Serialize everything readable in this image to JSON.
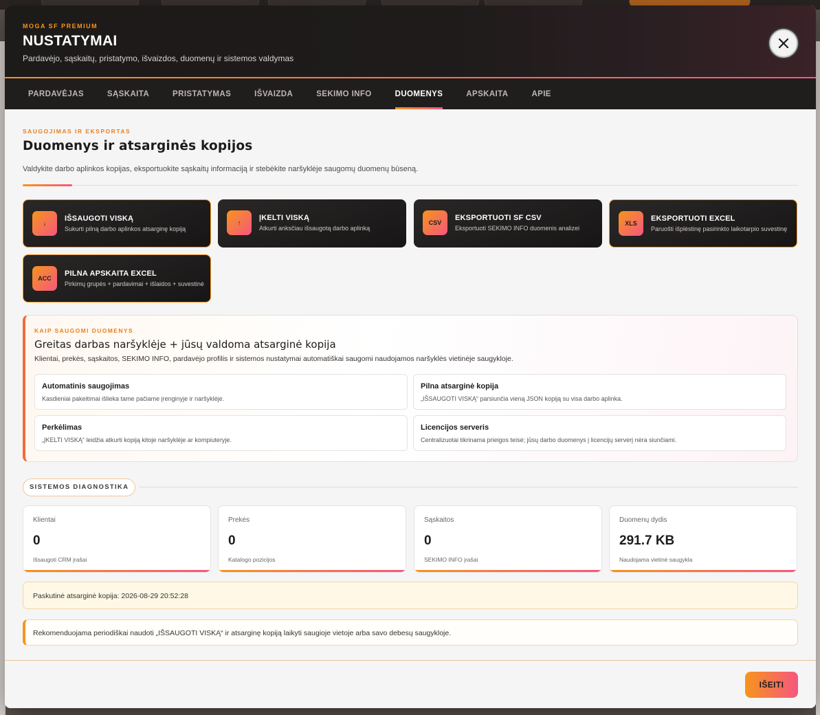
{
  "header": {
    "brand": "MOGA SF PREMIUM",
    "title": "NUSTATYMAI",
    "subtitle": "Pardavėjo, sąskaitų, pristatymo, išvaizdos, duomenų ir sistemos valdymas",
    "close_icon": "close-icon"
  },
  "tabs": [
    {
      "label": "PARDAVĖJAS"
    },
    {
      "label": "SĄSKAITA"
    },
    {
      "label": "PRISTATYMAS"
    },
    {
      "label": "IŠVAIZDA"
    },
    {
      "label": "SEKIMO INFO"
    },
    {
      "label": "DUOMENYS",
      "active": true
    },
    {
      "label": "APSKAITA"
    },
    {
      "label": "APIE"
    }
  ],
  "section": {
    "eyebrow": "SAUGOJIMAS IR EKSPORTAS",
    "title": "Duomenys ir atsarginės kopijos",
    "description": "Valdykite darbo aplinkos kopijas, eksportuokite sąskaitų informaciją ir stebėkite naršyklėje saugomų duomenų būseną."
  },
  "actions": [
    {
      "icon": "↓",
      "label": "IŠSAUGOTI VISKĄ",
      "sub": "Sukurti pilną darbo aplinkos atsarginę kopiją"
    },
    {
      "icon": "↑",
      "label": "ĮKELTI VISKĄ",
      "sub": "Atkurti anksčiau išsaugotą darbo aplinką"
    },
    {
      "icon": "CSV",
      "label": "EKSPORTUOTI SF CSV",
      "sub": "Eksportuoti SEKIMO INFO duomenis analizei"
    },
    {
      "icon": "XLS",
      "label": "EKSPORTUOTI EXCEL",
      "sub": "Paruošti išplėstinę pasirinkto laikotarpio suvestinę"
    },
    {
      "icon": "ACC",
      "label": "PILNA APSKAITA EXCEL",
      "sub": "Pirkimų grupės + pardavimai + išlaidos + suvestinė"
    }
  ],
  "info": {
    "eyebrow": "KAIP SAUGOMI DUOMENYS",
    "title": "Greitas darbas naršyklėje + jūsų valdoma atsarginė kopija",
    "text": "Klientai, prekės, sąskaitos, SEKIMO INFO, pardavėjo profilis ir sistemos nustatymai automatiškai saugomi naudojamos naršyklės vietinėje saugykloje.",
    "features": [
      {
        "title": "Automatinis saugojimas",
        "desc": "Kasdieniai pakeitimai išlieka tame pačiame įrenginyje ir naršyklėje."
      },
      {
        "title": "Pilna atsarginė kopija",
        "desc": "„IŠSAUGOTI VISKĄ“ parsiunčia vieną JSON kopiją su visa darbo aplinka."
      },
      {
        "title": "Perkėlimas",
        "desc": "„ĮKELTI VISKĄ“ leidžia atkurti kopiją kitoje naršyklėje ar kompiuteryje."
      },
      {
        "title": "Licencijos serveris",
        "desc": "Centralizuotai tikrinama prieigos teisė; jūsų darbo duomenys į licencijų serverį nėra siunčiami."
      }
    ]
  },
  "diagnostics": {
    "title": "SISTEMOS DIAGNOSTIKA",
    "stats": [
      {
        "label": "Klientai",
        "value": "0",
        "sub": "Išsaugoti CRM įrašai"
      },
      {
        "label": "Prekės",
        "value": "0",
        "sub": "Katalogo pozicijos"
      },
      {
        "label": "Sąskaitos",
        "value": "0",
        "sub": "SEKIMO INFO įrašai"
      },
      {
        "label": "Duomenų dydis",
        "value": "291.7 KB",
        "sub": "Naudojama vietinė saugykla"
      }
    ],
    "last_backup": "Paskutinė atsarginė kopija: 2026-08-29 20:52:28",
    "recommendation": "Rekomenduojama periodiškai naudoti „IŠSAUGOTI VISKĄ“ ir atsarginę kopiją laikyti saugioje vietoje arba savo debesų saugykloje."
  },
  "footer": {
    "exit_label": "IŠEITI"
  },
  "colors": {
    "accent_orange": "#f7941d",
    "accent_pink": "#f5577f",
    "dark": "#1d1a1a"
  }
}
